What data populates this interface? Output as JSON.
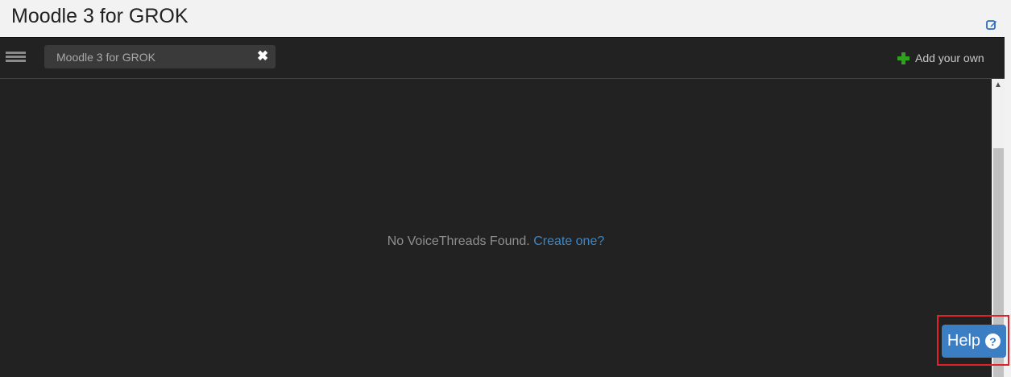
{
  "header": {
    "title": "Moodle 3 for GROK",
    "edit_icon": "edit-icon"
  },
  "toolbar": {
    "menu_icon": "hamburger-menu-icon",
    "search_value": "Moodle 3 for GROK",
    "clear_icon": "close-icon",
    "clear_glyph": "✖",
    "add_own_label": "Add your own",
    "add_own_icon": "plus-icon"
  },
  "main": {
    "empty_text": "No VoiceThreads Found.",
    "create_link": "Create one?"
  },
  "help": {
    "label": "Help",
    "icon": "question-circle-icon",
    "icon_glyph": "?"
  },
  "scrollbar": {
    "up_glyph": "▲"
  },
  "colors": {
    "background_dark": "#222222",
    "toolbar_search": "#3a3a3a",
    "accent_blue": "#3c7ec4",
    "link_blue": "#3d87c7",
    "plus_green": "#2fa11e",
    "highlight_red": "#e0232b"
  }
}
